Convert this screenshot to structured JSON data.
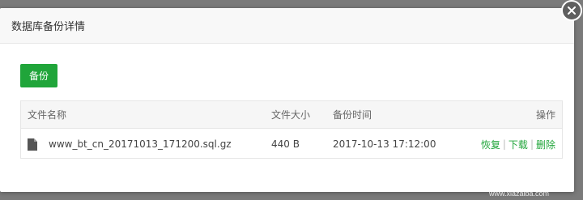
{
  "dialog": {
    "title": "数据库备份详情"
  },
  "toolbar": {
    "backup_label": "备份"
  },
  "table": {
    "headers": {
      "name": "文件名称",
      "size": "文件大小",
      "time": "备份时间",
      "ops": "操作"
    },
    "rows": [
      {
        "name": "www_bt_cn_20171013_171200.sql.gz",
        "size": "440 B",
        "time": "2017-10-13 17:12:00",
        "ops": {
          "restore": "恢复",
          "download": "下载",
          "delete": "删除",
          "sep": "|"
        }
      }
    ]
  },
  "watermark": {
    "logo_text": "下载吧",
    "url": "www.xiazaiba.com"
  },
  "colors": {
    "accent": "#20a53a",
    "backdrop": "#7a7a7a"
  },
  "icons": {
    "close": "close-icon",
    "file": "file-icon"
  }
}
